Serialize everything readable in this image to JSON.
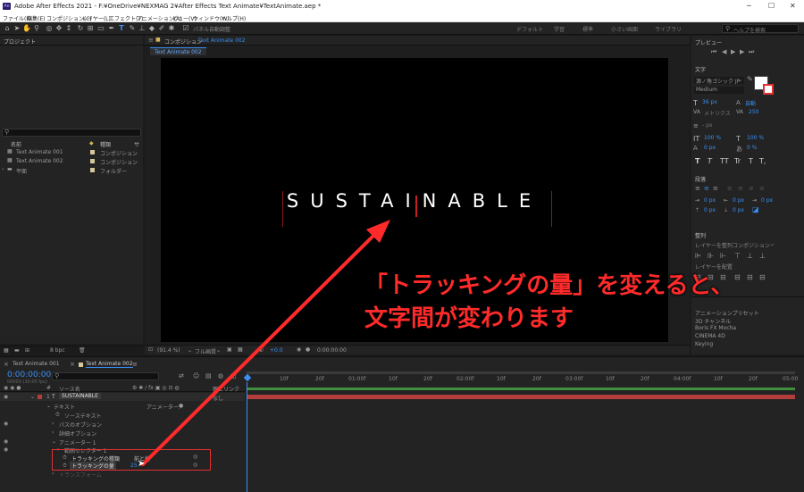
{
  "window": {
    "title": "Adobe After Effects 2021 - F:¥OneDrive¥NEXMAG 2¥After Effects Text Animate¥TextAnimate.aep *",
    "ae_badge": "Ae"
  },
  "menu": [
    "ファイル(F)",
    "編集(E)",
    "コンポジション(C)",
    "レイヤー(L)",
    "エフェクト(T)",
    "アニメーション(A)",
    "ビュー(V)",
    "ウィンドウ(W)",
    "ヘルプ(H)"
  ],
  "toolbar": {
    "align_label": "パネル自動調整",
    "workspaces": [
      "デフォルト",
      "学習",
      "標準",
      "小さい画面",
      "ライブラリ"
    ],
    "help_search_placeholder": "ヘルプを検索"
  },
  "project": {
    "title": "プロジェクト",
    "columns": [
      "名前",
      "種類",
      "サ"
    ],
    "items": [
      {
        "name": "Text Animate 001",
        "type": "コンポジション",
        "color": "#d4c79a"
      },
      {
        "name": "Text Animate 002",
        "type": "コンポジション",
        "color": "#d4c79a"
      },
      {
        "name": "平面",
        "type": "フォルダー",
        "color": "#d4c79a"
      }
    ],
    "bpc": "8 bpc"
  },
  "composition": {
    "panel_title": "コンポジション",
    "panel_name": "Text Animate 002",
    "tab": "Text Animate 002",
    "text": "SUSTAINABLE",
    "zoom": "(91.4 %)",
    "quality": "フル画質",
    "exposure": "+0.0",
    "timecode": "0:00:00:00"
  },
  "annotation": {
    "line1": "「トラッキングの量」を変えると、",
    "line2": "文字間が変わります",
    "color": "#ff2b2b"
  },
  "preview": {
    "title": "プレビュー"
  },
  "character": {
    "title": "文字",
    "font": "源ノ角ゴシック JP",
    "style": "Medium",
    "size": "36 px",
    "leading": "自動",
    "kerning": "メトリクス",
    "tracking": "250",
    "stroke": "- px",
    "vscale": "100 %",
    "hscale": "100 %",
    "baseline": "0 px",
    "tsume": "0 %",
    "styles": [
      "T",
      "T",
      "TT",
      "Tr",
      "T",
      "T,"
    ]
  },
  "paragraph": {
    "title": "段落",
    "indent1": "0 px",
    "indent2": "0 px",
    "indent3": "0 px",
    "space1": "0 px",
    "space2": "0 px"
  },
  "align": {
    "title": "整列",
    "layer_align_label": "レイヤーを整列",
    "target": "コンポジション",
    "distribute_label": "レイヤーを配置"
  },
  "effects": {
    "items": [
      "アニメーションプリセット",
      "3D チャンネル",
      "Boris FX Mocha",
      "CINEMA 4D",
      "Keying"
    ]
  },
  "timeline": {
    "tabs": [
      "Text Animate 001",
      "Text Animate 002"
    ],
    "timecode": "0:00:00:00",
    "timecode_sub": "00000 (30.00 fps)",
    "search_placeholder": "",
    "header": {
      "source": "ソース名",
      "parent": "親とリンク"
    },
    "ticks": [
      "10f",
      "20f",
      "01:00f",
      "10f",
      "20f",
      "02:00f",
      "10f",
      "20f",
      "03:00f",
      "10f",
      "20f",
      "04:00f",
      "10f",
      "20f",
      "05:00"
    ],
    "layer": {
      "num": "1",
      "name": "SUSTAINABLE",
      "parent": "なし"
    },
    "props": [
      {
        "name": "テキスト",
        "extra": "アニメーター:"
      },
      {
        "name": "ソーステキスト",
        "extra": ""
      },
      {
        "name": "パスのオプション",
        "extra": ""
      },
      {
        "name": "詳細オプション",
        "extra": ""
      },
      {
        "name": "アニメーター 1",
        "extra": ""
      },
      {
        "name": "範囲セレクター 1",
        "extra": ""
      },
      {
        "name": "トラッキングの種類",
        "extra": "前と後"
      },
      {
        "name": "トラッキングの量",
        "extra": "25"
      },
      {
        "name": "トランスフォーム",
        "extra": ""
      }
    ]
  },
  "colors": {
    "accent": "#3b8ff5",
    "annotation_red": "#ff2b2b",
    "layer_bar": "#b33c3c",
    "track_bar": "#3f8f3f"
  }
}
